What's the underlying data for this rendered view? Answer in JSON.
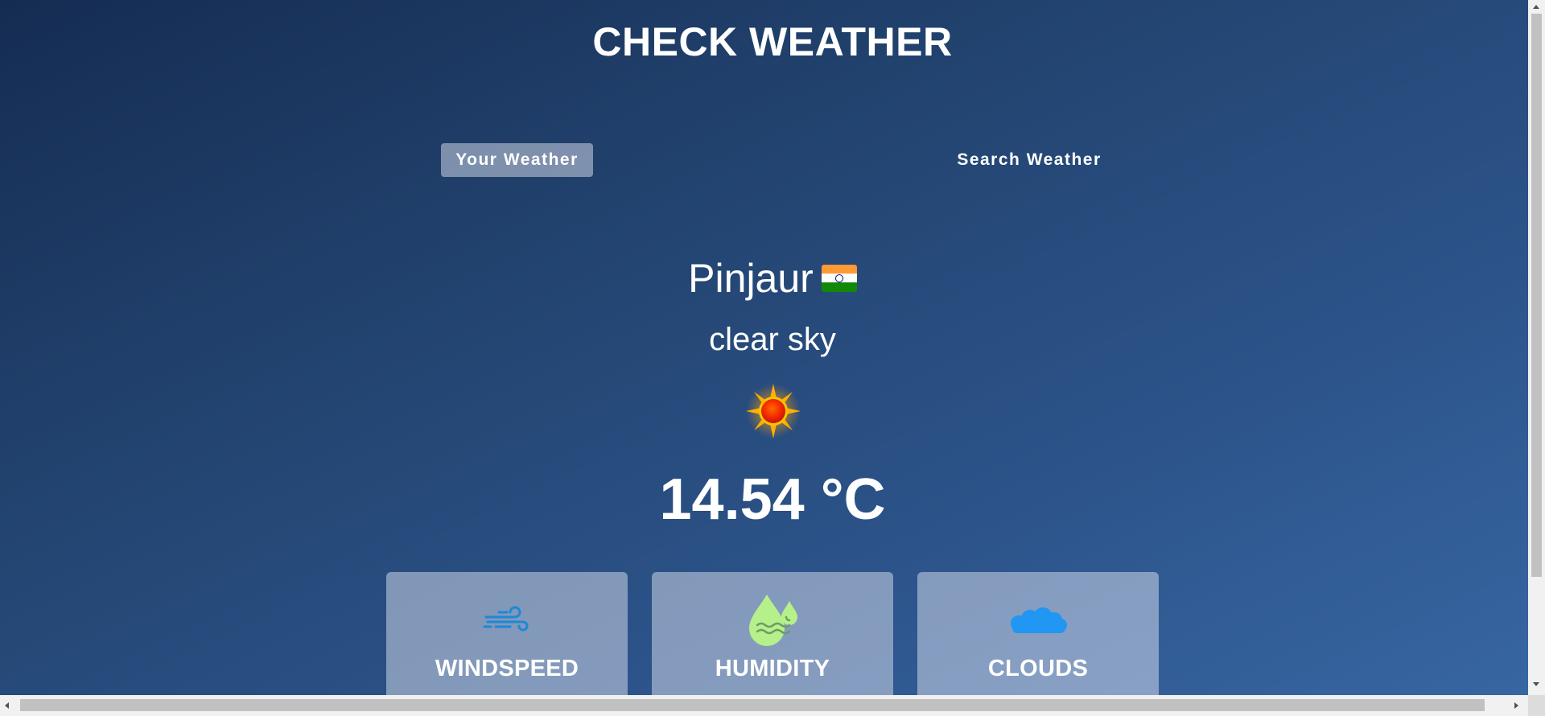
{
  "page": {
    "title": "CHECK WEATHER"
  },
  "tabs": {
    "your_weather": "Your Weather",
    "search_weather": "Search Weather",
    "active": "your_weather"
  },
  "weather": {
    "city": "Pinjaur",
    "country_flag_icon": "india-flag-icon",
    "description": "clear sky",
    "condition_icon": "sun-icon",
    "temperature": "14.54 °C"
  },
  "cards": [
    {
      "label": "WINDSPEED",
      "icon": "wind-icon",
      "icon_color": "#1e88d6"
    },
    {
      "label": "HUMIDITY",
      "icon": "humidity-icon",
      "icon_color": "#b6f08a"
    },
    {
      "label": "CLOUDS",
      "icon": "cloud-icon",
      "icon_color": "#2196f3"
    }
  ],
  "colors": {
    "background_start": "#152c52",
    "background_end": "#3867a3",
    "card_background": "rgba(219,226,239,0.5)"
  }
}
